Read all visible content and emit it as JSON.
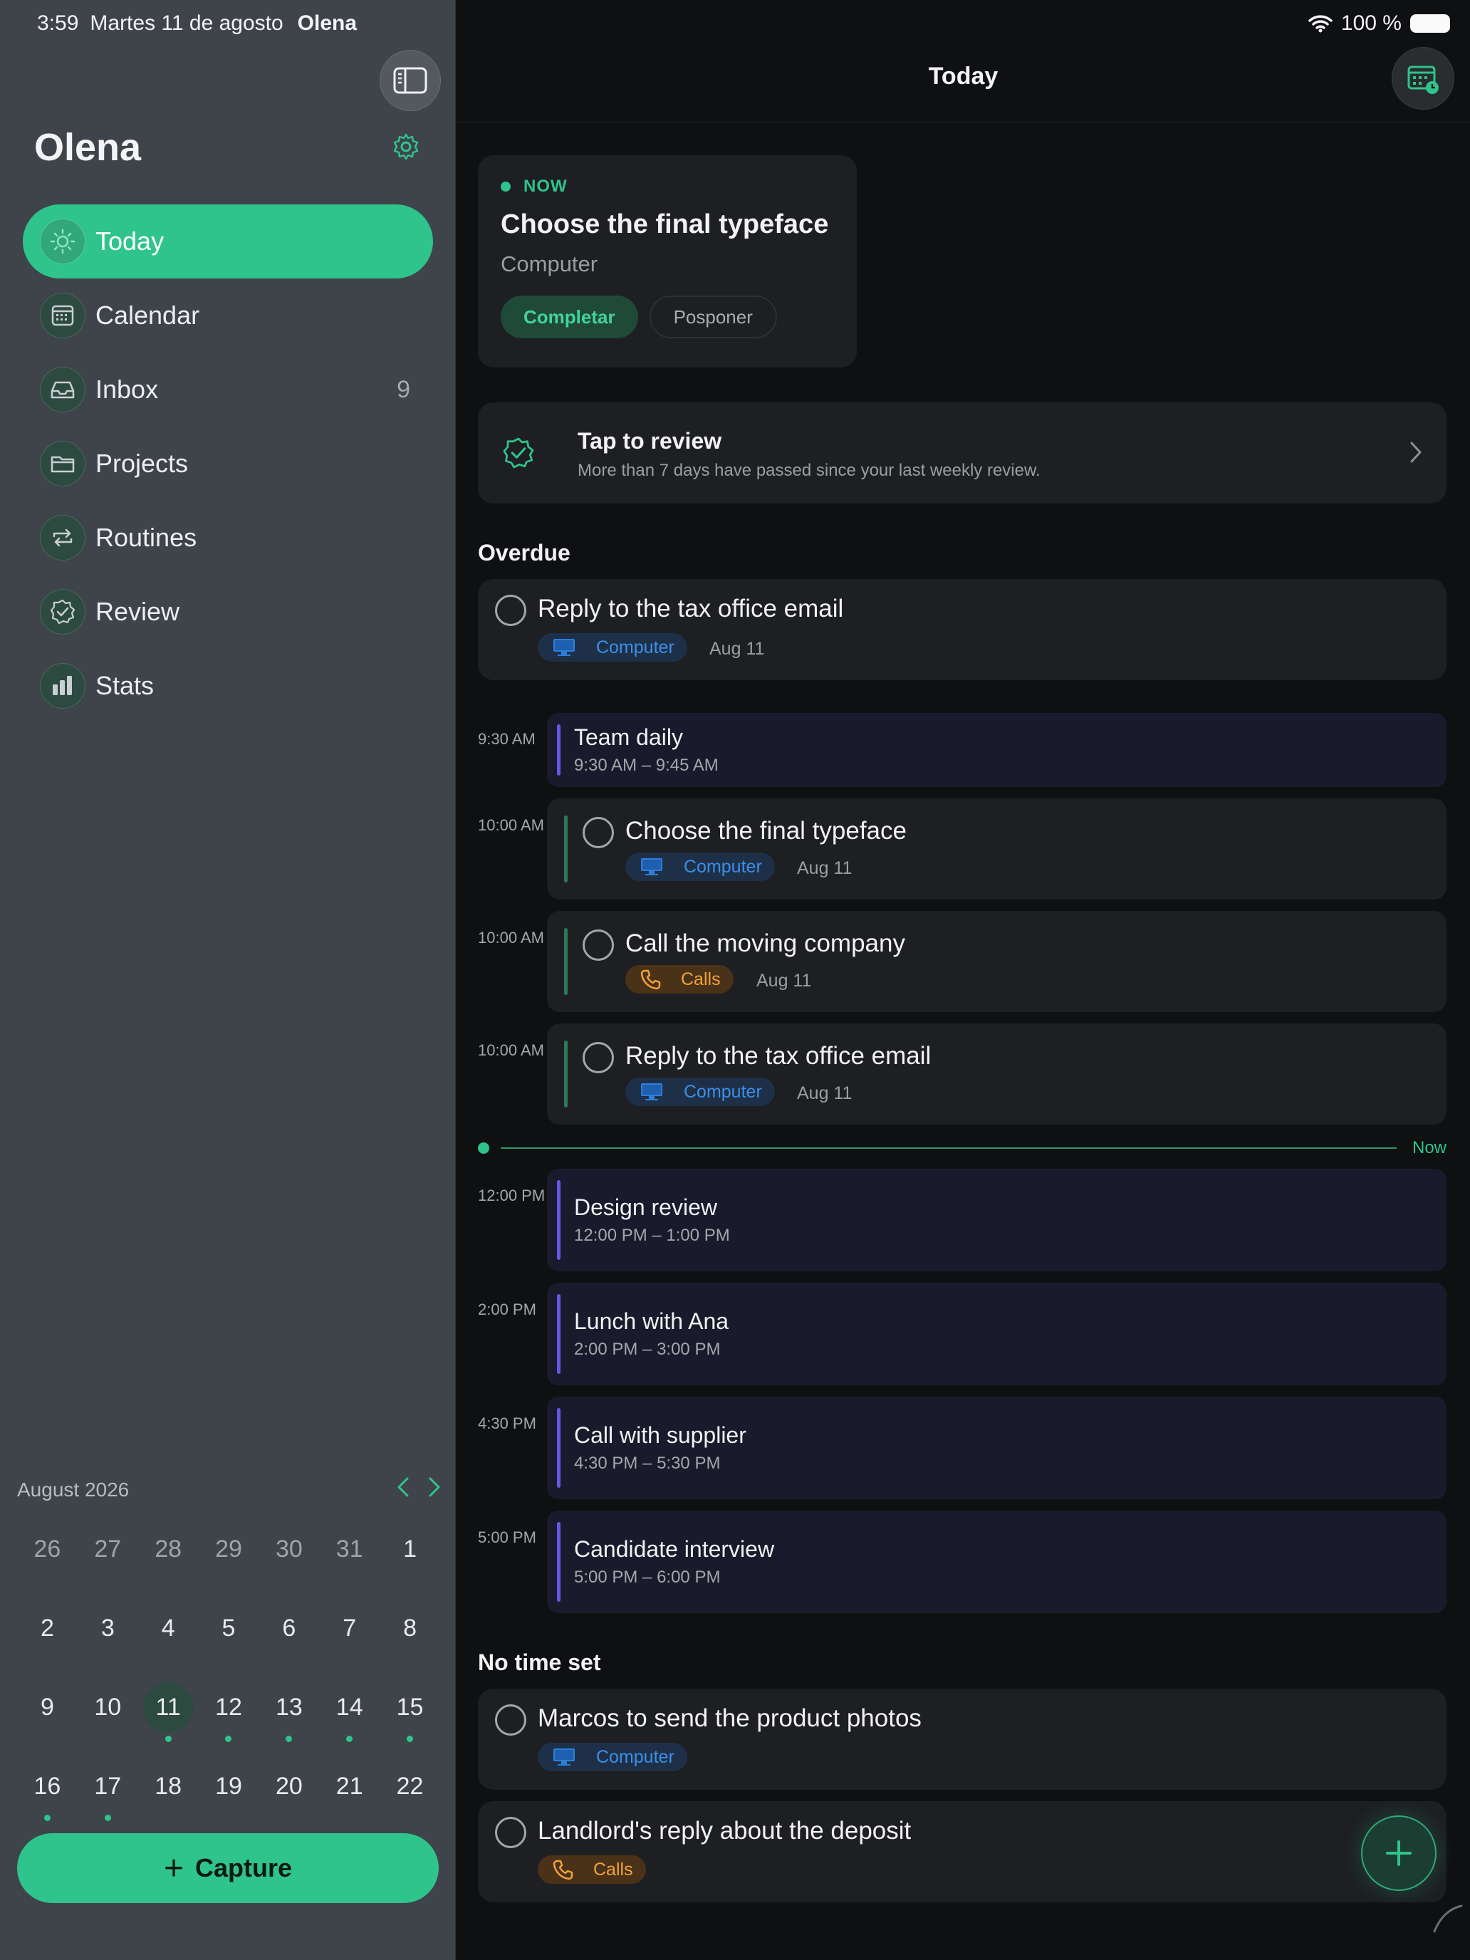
{
  "status_bar": {
    "time": "3:59",
    "date": "Martes 11 de agosto",
    "owner": "Olena",
    "battery": "100 %"
  },
  "sidebar": {
    "user_name": "Olena",
    "nav": [
      {
        "label": "Today",
        "icon": "sun-icon",
        "active": true
      },
      {
        "label": "Calendar",
        "icon": "calendar-icon"
      },
      {
        "label": "Inbox",
        "icon": "inbox-icon",
        "count": "9"
      },
      {
        "label": "Projects",
        "icon": "folder-icon"
      },
      {
        "label": "Routines",
        "icon": "repeat-icon"
      },
      {
        "label": "Review",
        "icon": "check-badge-icon"
      },
      {
        "label": "Stats",
        "icon": "bar-chart-icon"
      }
    ],
    "calendar": {
      "month": "August 2026",
      "weeks": [
        [
          "26",
          "27",
          "28",
          "29",
          "30",
          "31",
          "1"
        ],
        [
          "2",
          "3",
          "4",
          "5",
          "6",
          "7",
          "8"
        ],
        [
          "9",
          "10",
          "11",
          "12",
          "13",
          "14",
          "15"
        ],
        [
          "16",
          "17",
          "18",
          "19",
          "20",
          "21",
          "22"
        ]
      ],
      "selected_day": "11",
      "days_with_events": [
        "11",
        "12",
        "13",
        "14",
        "15",
        "16",
        "17"
      ]
    },
    "capture_label": "Capture"
  },
  "main": {
    "title": "Today",
    "now_card": {
      "badge": "NOW",
      "title": "Choose the final typeface",
      "context": "Computer",
      "complete_label": "Completar",
      "postpone_label": "Posponer"
    },
    "review": {
      "title": "Tap to review",
      "subtitle": "More than 7 days have passed since your last weekly review."
    },
    "overdue_heading": "Overdue",
    "overdue": [
      {
        "title": "Reply to the tax office email",
        "context": "Computer",
        "date": "Aug 11"
      }
    ],
    "timeline": [
      {
        "time": "9:30 AM",
        "kind": "event",
        "title": "Team daily",
        "range": "9:30 AM – 9:45 AM"
      },
      {
        "time": "10:00 AM",
        "kind": "task",
        "title": "Choose the final typeface",
        "context": "Computer",
        "date": "Aug 11"
      },
      {
        "time": "10:00 AM",
        "kind": "task",
        "title": "Call the moving company",
        "context": "Calls",
        "date": "Aug 11"
      },
      {
        "time": "10:00 AM",
        "kind": "task",
        "title": "Reply to the tax office email",
        "context": "Computer",
        "date": "Aug 11"
      },
      {
        "time": "12:00 PM",
        "kind": "event",
        "title": "Design review",
        "range": "12:00 PM – 1:00 PM"
      },
      {
        "time": "2:00 PM",
        "kind": "event",
        "title": "Lunch with Ana",
        "range": "2:00 PM – 3:00 PM"
      },
      {
        "time": "4:30 PM",
        "kind": "event",
        "title": "Call with supplier",
        "range": "4:30 PM – 5:30 PM"
      },
      {
        "time": "5:00 PM",
        "kind": "event",
        "title": "Candidate interview",
        "range": "5:00 PM – 6:00 PM"
      }
    ],
    "now_marker": "Now",
    "no_time_heading": "No time set",
    "no_time": [
      {
        "title": "Marcos to send the product photos",
        "context": "Computer"
      },
      {
        "title": "Landlord's reply about the deposit",
        "context": "Calls"
      }
    ]
  },
  "colors": {
    "accent": "#2fc48c",
    "computer_chip": "#3d8fe8",
    "calls_chip": "#f0a23c",
    "event_bar": "#6458e8"
  }
}
